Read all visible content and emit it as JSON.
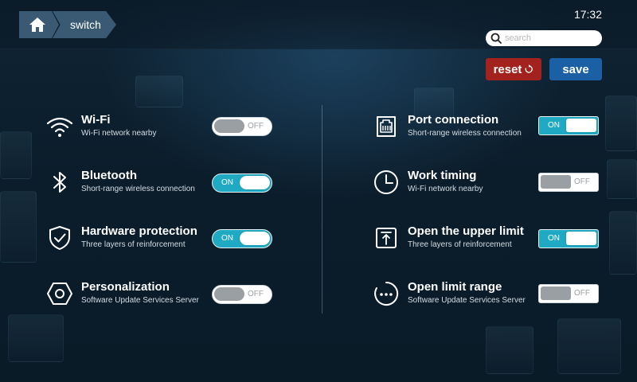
{
  "breadcrumb": {
    "home_icon": "home-icon",
    "current": "switch"
  },
  "clock": "17:32",
  "search": {
    "placeholder": "search",
    "value": "",
    "icon": "search-icon"
  },
  "actions": {
    "reset_label": "reset",
    "reset_icon": "refresh-icon",
    "save_label": "save"
  },
  "colors": {
    "toggle_on": "#1fa9c2",
    "reset": "#a3221d",
    "save": "#1b5fa5"
  },
  "settings_left": [
    {
      "icon": "wifi-icon",
      "title": "Wi-Fi",
      "subtitle": "Wi-Fi network nearby",
      "state": "OFF"
    },
    {
      "icon": "bluetooth-icon",
      "title": "Bluetooth",
      "subtitle": "Short-range wireless connection",
      "state": "ON"
    },
    {
      "icon": "shield-check-icon",
      "title": "Hardware protection",
      "subtitle": "Three layers of reinforcement",
      "state": "ON"
    },
    {
      "icon": "hexagon-settings-icon",
      "title": "Personalization",
      "subtitle": "Software Update Services Server",
      "state": "OFF"
    }
  ],
  "settings_right": [
    {
      "icon": "ethernet-port-icon",
      "title": "Port connection",
      "subtitle": "Short-range wireless connection",
      "state": "ON"
    },
    {
      "icon": "clock-icon",
      "title": "Work timing",
      "subtitle": "Wi-Fi network nearby",
      "state": "OFF"
    },
    {
      "icon": "upload-limit-icon",
      "title": "Open the upper limit",
      "subtitle": "Three layers of reinforcement",
      "state": "ON"
    },
    {
      "icon": "more-dots-icon",
      "title": "Open limit range",
      "subtitle": "Software Update Services Server",
      "state": "OFF"
    }
  ]
}
